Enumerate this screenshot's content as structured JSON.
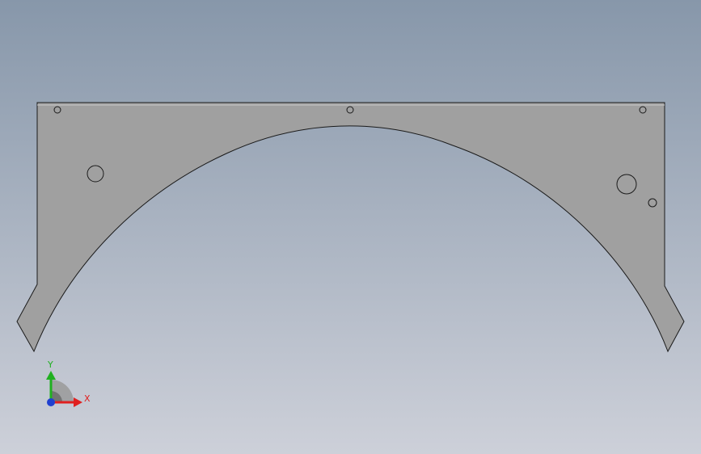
{
  "viewport": {
    "background_top": "#8797aa",
    "background_bottom": "#cdd0d9"
  },
  "part": {
    "fill": "#a0a0a0",
    "stroke": "#1a1a1a",
    "holes_count": 6
  },
  "triad": {
    "x_label": "X",
    "y_label": "Y",
    "x_color": "#e02020",
    "y_color": "#20b020",
    "z_color": "#2040d0"
  }
}
